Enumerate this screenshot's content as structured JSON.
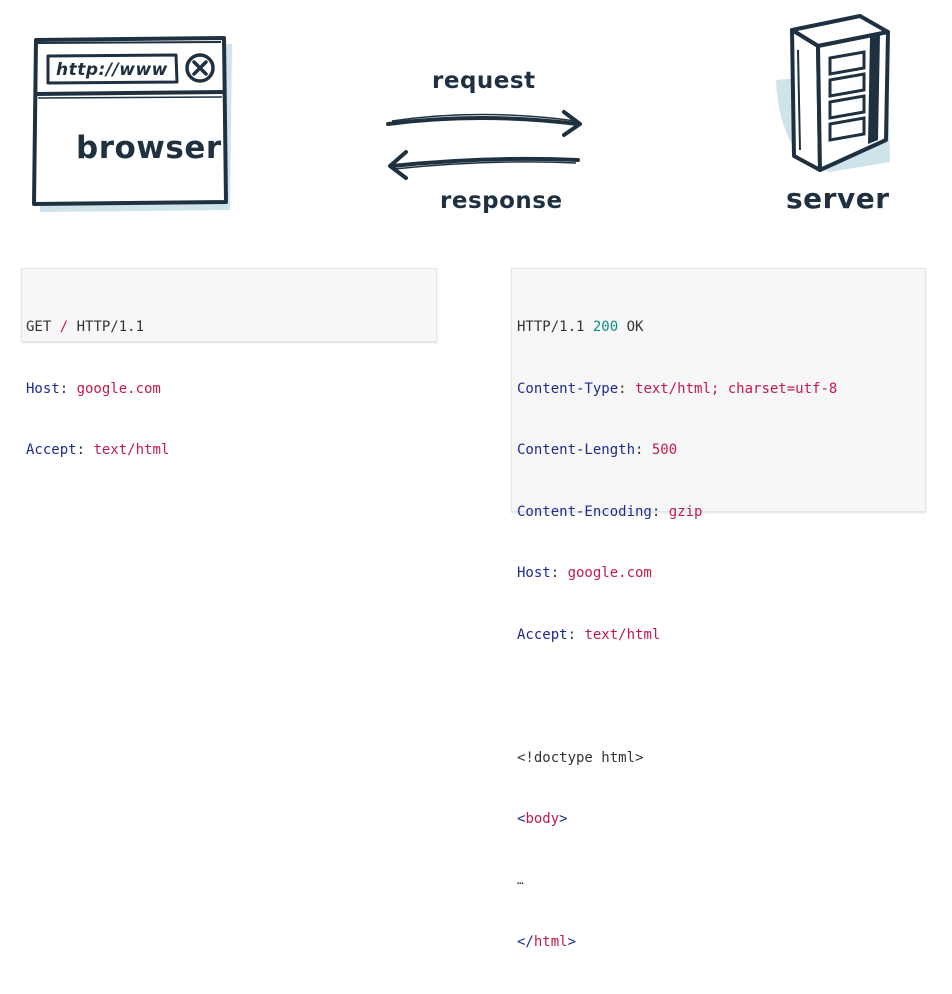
{
  "browser": {
    "url_text": "http://www",
    "label": "browser"
  },
  "arrows": {
    "request_label": "request",
    "response_label": "response"
  },
  "server": {
    "label": "server"
  },
  "request_block": {
    "line1": {
      "method": "GET ",
      "path": "/",
      "version": " HTTP/1.1"
    },
    "line2": {
      "key": "Host",
      "sep": ": ",
      "value": "google.com"
    },
    "line3": {
      "key": "Accept",
      "sep": ": ",
      "value": "text/html"
    }
  },
  "response_block": {
    "status": {
      "version": "HTTP/1.1 ",
      "code": "200",
      "text": " OK"
    },
    "headers": [
      {
        "key": "Content-Type",
        "sep": ": ",
        "value": "text/html; charset=utf-8"
      },
      {
        "key": "Content-Length",
        "sep": ": ",
        "value": "500"
      },
      {
        "key": "Content-Encoding",
        "sep": ": ",
        "value": "gzip"
      },
      {
        "key": "Host",
        "sep": ": ",
        "value": "google.com"
      },
      {
        "key": "Accept",
        "sep": ": ",
        "value": "text/html"
      }
    ],
    "doctype": "<!doctype html>",
    "body_open": {
      "lt": "<",
      "tag": "body",
      "gt": ">"
    },
    "ellipsis": "…",
    "html_close": {
      "lt": "</",
      "tag": "html",
      "gt": ">"
    }
  },
  "colors": {
    "ink": "#1f3140",
    "shadow": "#cfe3ea",
    "keyword": "#1d2c8c",
    "string": "#c41a4b",
    "number": "#118a88"
  }
}
